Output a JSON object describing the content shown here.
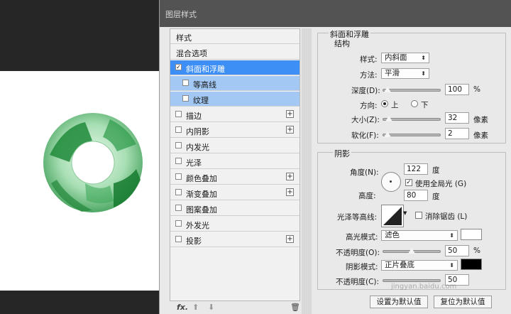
{
  "dialog": {
    "title": "图层样式"
  },
  "list": {
    "items": [
      {
        "label": "样式",
        "checkbox": false,
        "plus": false
      },
      {
        "label": "混合选项",
        "checkbox": false,
        "plus": false
      },
      {
        "label": "斜面和浮雕",
        "checkbox": true,
        "checked": true,
        "plus": false,
        "selected": true
      },
      {
        "label": "等高线",
        "checkbox": true,
        "checked": false,
        "plus": false,
        "sub": true
      },
      {
        "label": "纹理",
        "checkbox": true,
        "checked": false,
        "plus": false,
        "sub": true
      },
      {
        "label": "描边",
        "checkbox": true,
        "checked": false,
        "plus": true
      },
      {
        "label": "内阴影",
        "checkbox": true,
        "checked": false,
        "plus": true
      },
      {
        "label": "内发光",
        "checkbox": true,
        "checked": false,
        "plus": false
      },
      {
        "label": "光泽",
        "checkbox": true,
        "checked": false,
        "plus": false
      },
      {
        "label": "颜色叠加",
        "checkbox": true,
        "checked": false,
        "plus": true
      },
      {
        "label": "渐变叠加",
        "checkbox": true,
        "checked": false,
        "plus": true
      },
      {
        "label": "图案叠加",
        "checkbox": true,
        "checked": false,
        "plus": false
      },
      {
        "label": "外发光",
        "checkbox": true,
        "checked": false,
        "plus": false
      },
      {
        "label": "投影",
        "checkbox": true,
        "checked": false,
        "plus": true
      }
    ],
    "footer": {
      "fx": "fx.",
      "up": "⬆",
      "down": "⬇",
      "trash": "🗑"
    }
  },
  "bevel": {
    "section_title": "斜面和浮雕",
    "structure_title": "结构",
    "style_label": "样式:",
    "style_value": "内斜面",
    "method_label": "方法:",
    "method_value": "平滑",
    "depth_label": "深度(D):",
    "depth_value": "100",
    "depth_unit": "%",
    "direction_label": "方向:",
    "dir_up": "上",
    "dir_down": "下",
    "size_label": "大小(Z):",
    "size_value": "32",
    "size_unit": "像素",
    "soften_label": "软化(F):",
    "soften_value": "2",
    "soften_unit": "像素"
  },
  "shading": {
    "title": "阴影",
    "angle_label": "角度(N):",
    "angle_value": "122",
    "angle_unit": "度",
    "global_light": "使用全局光 (G)",
    "altitude_label": "高度:",
    "altitude_value": "80",
    "altitude_unit": "度",
    "gloss_label": "光泽等高线:",
    "antialias": "消除锯齿 (L)",
    "highlight_label": "高光模式:",
    "highlight_value": "滤色",
    "highlight_color": "#ffffff",
    "opacity1_label": "不透明度(O):",
    "opacity1_value": "50",
    "opacity_unit": "%",
    "shadow_label": "阴影模式:",
    "shadow_value": "正片叠底",
    "shadow_color": "#000000",
    "opacity2_label": "不透明度(C):",
    "opacity2_value": "50"
  },
  "buttons": {
    "default_set": "设置为默认值",
    "default_reset": "复位为默认值"
  },
  "watermark": "jingyan.baidu.com"
}
